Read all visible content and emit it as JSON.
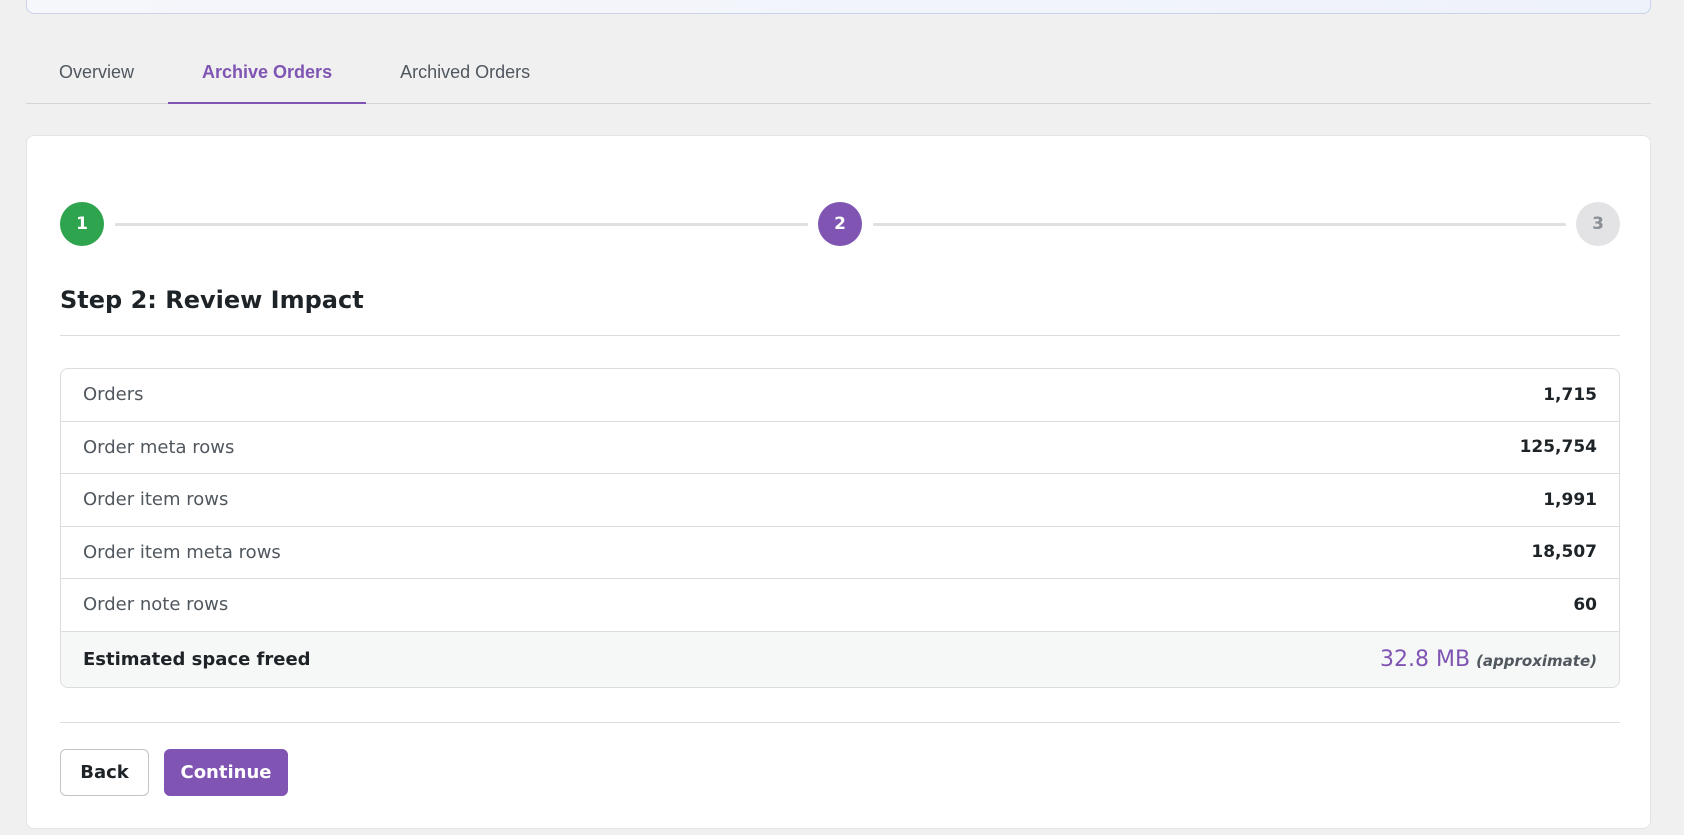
{
  "tabs": [
    {
      "label": "Overview",
      "active": false
    },
    {
      "label": "Archive Orders",
      "active": true
    },
    {
      "label": "Archived Orders",
      "active": false
    }
  ],
  "stepper": {
    "steps": [
      "1",
      "2",
      "3"
    ],
    "current": 2,
    "colors": {
      "done": "#2ea44f",
      "current": "#7f54b3",
      "pending": "#e3e3e5"
    }
  },
  "step_title": "Step 2: Review Impact",
  "summary": {
    "rows": [
      {
        "label": "Orders",
        "value": "1,715"
      },
      {
        "label": "Order meta rows",
        "value": "125,754"
      },
      {
        "label": "Order item rows",
        "value": "1,991"
      },
      {
        "label": "Order item meta rows",
        "value": "18,507"
      },
      {
        "label": "Order note rows",
        "value": "60"
      }
    ],
    "total_label": "Estimated space freed",
    "total_value": "32.8 MB",
    "total_note": "(approximate)"
  },
  "buttons": {
    "back_label": "Back",
    "continue_label": "Continue"
  },
  "accent_color": "#7f54b3"
}
